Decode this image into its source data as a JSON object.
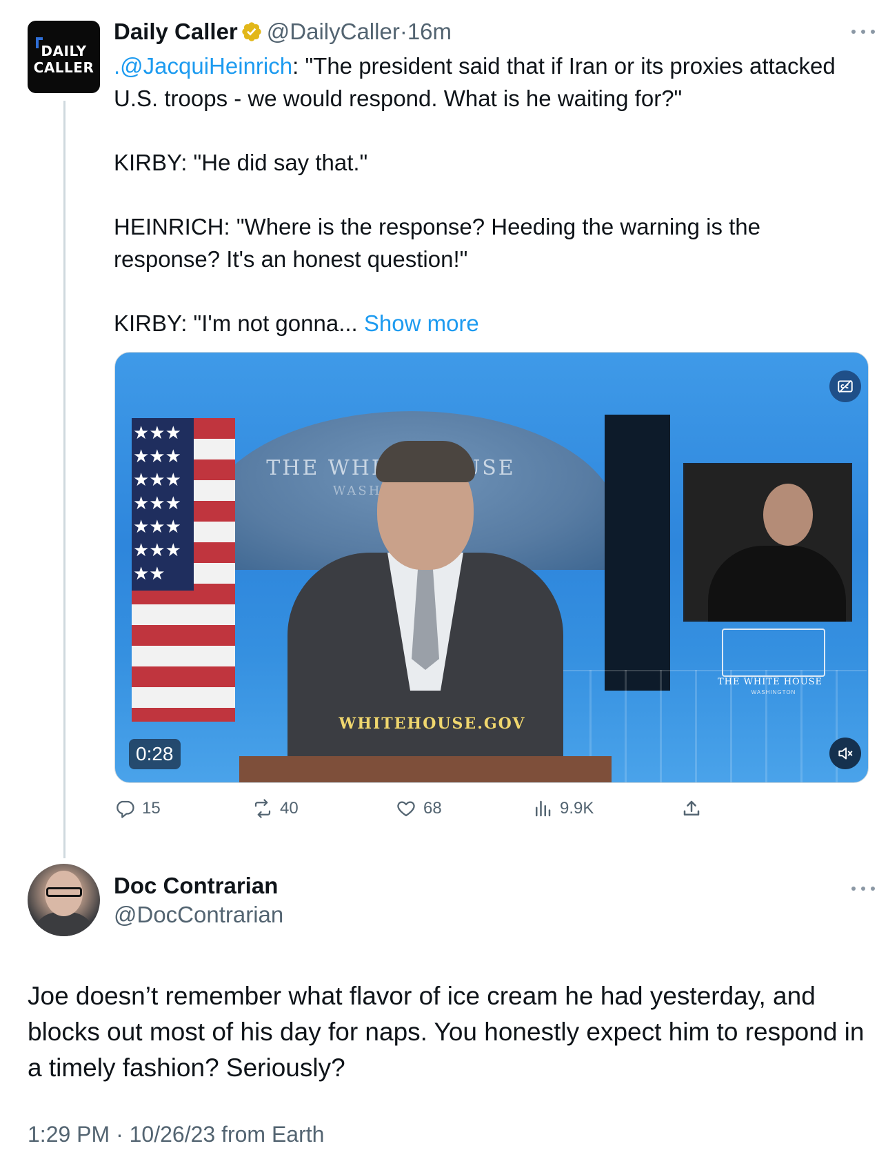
{
  "tweet": {
    "author": {
      "name": "Daily Caller",
      "handle": "@DailyCaller",
      "dot": "·",
      "time": "16m",
      "avatar_line_1": "DAILY",
      "avatar_line_2": "CALLER",
      "verified_icon": "verified-badge-icon"
    },
    "mention": ".@JacquiHeinrich",
    "line_1": ": \"The president said that if Iran or its proxies attacked U.S. troops - we would respond. What is he waiting for?\"",
    "line_2": "KIRBY: \"He did say that.\"",
    "line_3": "HEINRICH: \"Where is the response? Heeding the warning is the response? It's an honest question!\"",
    "line_4": "KIRBY: \"I'm not gonna... ",
    "show_more": "Show more",
    "video": {
      "duration": "0:28",
      "seal_text_1": "THE WHITE HOUSE",
      "seal_text_2": "WASHINGTON",
      "website": "WHITEHOUSE.GOV",
      "logo_text": "THE WHITE HOUSE",
      "logo_subtext": "WASHINGTON",
      "caption_icon": "closed-captions-icon",
      "mute_icon": "speaker-muted-icon"
    },
    "actions": {
      "replies": "15",
      "reposts": "40",
      "likes": "68",
      "views": "9.9K"
    }
  },
  "reply": {
    "author": {
      "name": "Doc Contrarian",
      "handle": "@DocContrarian"
    },
    "text": "Joe doesn’t remember what flavor of ice cream he had yesterday, and blocks out most of his day for naps. You honestly expect him to respond in a timely fashion? Seriously?",
    "timestamp": "1:29 PM · 10/26/23 from Earth"
  },
  "colors": {
    "link": "#1d9bf0",
    "secondary_text": "#536471",
    "verified_gold": "#e2b719"
  }
}
